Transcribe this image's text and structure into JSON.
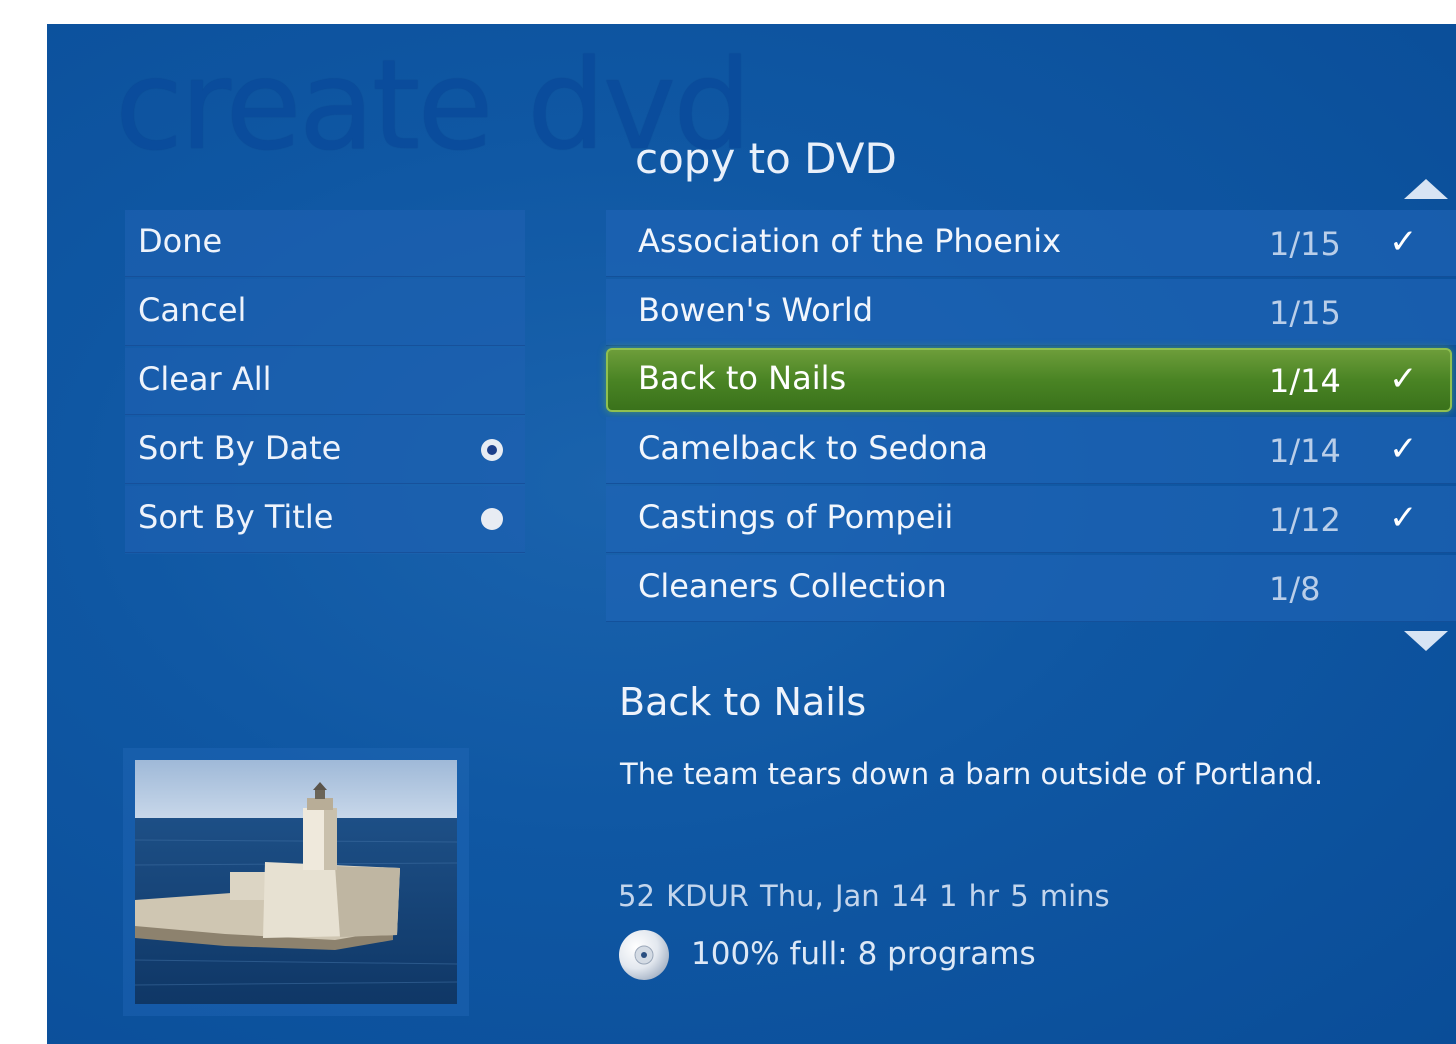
{
  "page": {
    "background_title": "create dvd",
    "section_title": "copy to DVD"
  },
  "menu": {
    "items": [
      {
        "label": "Done"
      },
      {
        "label": "Cancel"
      },
      {
        "label": "Clear All"
      },
      {
        "label": "Sort By Date",
        "radio": "selected"
      },
      {
        "label": "Sort By Title",
        "radio": "unselected"
      }
    ]
  },
  "list": {
    "rows": [
      {
        "title": "Association of the Phoenix",
        "date": "1/15",
        "checked": "✓"
      },
      {
        "title": "Bowen's World",
        "date": "1/15",
        "checked": ""
      },
      {
        "title": "Back to Nails",
        "date": "1/14",
        "checked": "✓",
        "focused": true
      },
      {
        "title": "Camelback to Sedona",
        "date": "1/14",
        "checked": "✓"
      },
      {
        "title": "Castings of Pompeii",
        "date": "1/12",
        "checked": "✓"
      },
      {
        "title": "Cleaners Collection",
        "date": "1/8",
        "checked": ""
      }
    ],
    "scroll_up_icon": "triangle-up",
    "scroll_down_icon": "triangle-down"
  },
  "detail": {
    "title": "Back to Nails",
    "description": "The team tears down a barn outside of Portland.",
    "meta": "52 KDUR   Thu, Jan 14   1 hr 5 mins",
    "disc_status": "100% full:  8 programs",
    "disc_icon": "dvd-disc"
  },
  "colors": {
    "background": "#0f57a3",
    "focus_green": "#4a8424",
    "text": "#eef3fb"
  }
}
